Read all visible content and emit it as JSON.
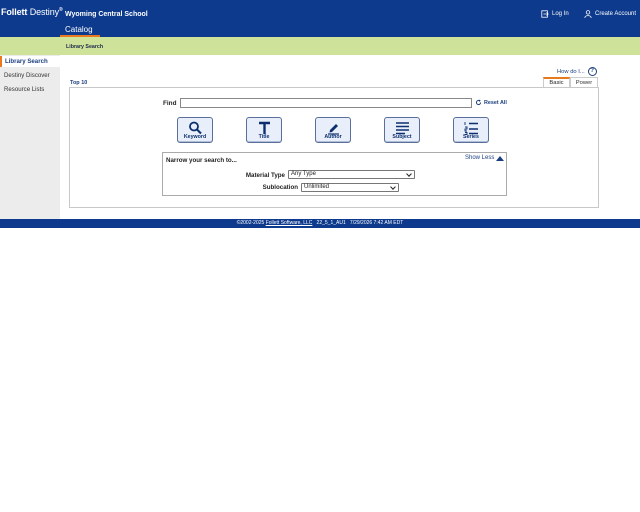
{
  "header": {
    "brand_follett": "Follett",
    "brand_destiny": "Destiny",
    "brand_mark": "®",
    "school": "Wyoming Central School",
    "tab_catalog": "Catalog",
    "login": "Log In",
    "create_account": "Create Account",
    "colors": {
      "primary": "#0d3a8c",
      "accent": "#e8791f",
      "subbar": "#cfe29a"
    }
  },
  "breadcrumb": "Library Search",
  "sidebar": {
    "items": [
      {
        "label": "Library Search",
        "active": true
      },
      {
        "label": "Destiny Discover",
        "active": false
      },
      {
        "label": "Resource Lists",
        "active": false
      }
    ]
  },
  "main": {
    "how_do_i": "How do I...",
    "help_icon": "?",
    "top10": "Top 10",
    "tabs": [
      {
        "label": "Basic",
        "active": true
      },
      {
        "label": "Power",
        "active": false
      }
    ],
    "find_label": "Find",
    "find_value": "",
    "reset_all": "Reset All",
    "search_buttons": [
      {
        "label": "Keyword",
        "icon": "magnifier-icon"
      },
      {
        "label": "Title",
        "icon": "title-t-icon"
      },
      {
        "label": "Author",
        "icon": "pen-icon"
      },
      {
        "label": "Subject",
        "icon": "lines-icon"
      },
      {
        "label": "Series",
        "icon": "numbered-list-icon"
      }
    ],
    "narrow_title": "Narrow your search to...",
    "show_less": "Show Less",
    "material_type_label": "Material Type",
    "material_type_value": "Any Type",
    "sublocation_label": "Sublocation",
    "sublocation_value": "Unlimited"
  },
  "footer": {
    "copyright": "©2002-2025",
    "company": "Follett Software, LLC",
    "version": "22_5_1_AU1",
    "timestamp": "7/29/2026 7:42 AM EDT"
  }
}
